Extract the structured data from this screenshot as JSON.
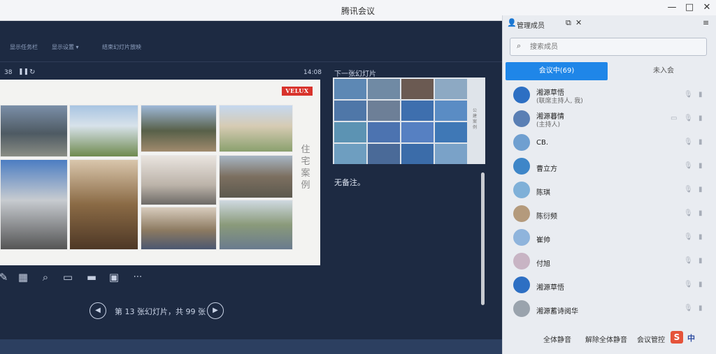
{
  "window": {
    "title": "腾讯会议",
    "minimize": "—",
    "maximize": "□",
    "close": "✕"
  },
  "ppt_toolbar": {
    "items": [
      "显示任务栏",
      "显示设置 ▾",
      "结束幻灯片放映"
    ]
  },
  "presenter": {
    "elapsed": "38",
    "clock": "14:08",
    "slide_brand": "VELUX",
    "slide_tag": "住宅案例",
    "controls": [
      "pen-icon",
      "grid-icon",
      "zoom-icon",
      "screen-icon",
      "monitor-icon",
      "camera-icon",
      "more-icon"
    ],
    "slide_counter": "第 13 张幻灯片，共 99 张",
    "next_slide_label": "下一张幻灯片",
    "next_slide_tag": "公建案例",
    "notes": "无备注。"
  },
  "panel": {
    "title": "管理成员",
    "search_placeholder": "搜索成员",
    "tab_in_meeting": "会议中(69)",
    "tab_not_joined": "未入会",
    "members": [
      {
        "name": "湘源草悟",
        "role": "(联席主持人, 我)"
      },
      {
        "name": "湘源暮情",
        "role": "(主持人)"
      },
      {
        "name": "CB.",
        "role": ""
      },
      {
        "name": "曹立方",
        "role": ""
      },
      {
        "name": "陈琪",
        "role": ""
      },
      {
        "name": "陈衍频",
        "role": ""
      },
      {
        "name": "崔帅",
        "role": ""
      },
      {
        "name": "付旭",
        "role": ""
      },
      {
        "name": "湘源草悟",
        "role": ""
      },
      {
        "name": "湘源蓄诗阅华",
        "role": ""
      }
    ],
    "footer": {
      "mute_all": "全体静音",
      "unmute_all": "解除全体静音",
      "manage": "会议管控",
      "ime_mode": "中"
    }
  },
  "colors": {
    "accent": "#1f86e8",
    "presenter_bg": "#1d2a42",
    "velux_red": "#d8332c"
  }
}
